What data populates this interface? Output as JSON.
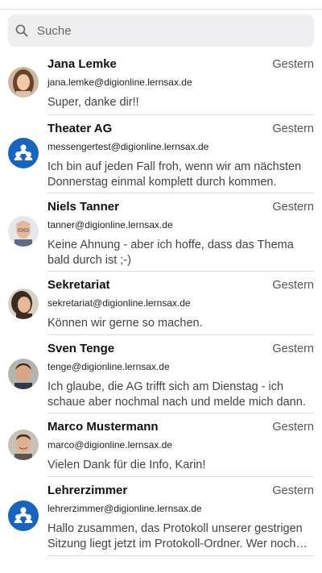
{
  "search": {
    "placeholder": "Suche"
  },
  "contacts": [
    {
      "name": "Jana Lemke",
      "time": "Gestern",
      "email": "jana.lemke@digionline.lernsax.de",
      "preview": "Super, danke dir!!",
      "avatar": "photo-woman-brown-hair"
    },
    {
      "name": "Theater AG",
      "time": "Gestern",
      "email": "messengertest@digionline.lernsax.de",
      "preview": "Ich bin auf jeden Fall froh, wenn wir am nächsten Donnerstag einmal komplett durch kommen.",
      "avatar": "group-icon"
    },
    {
      "name": "Niels Tanner",
      "time": "Gestern",
      "email": "tanner@digionline.lernsax.de",
      "preview": "Keine Ahnung - aber ich hoffe, dass das Thema bald durch ist ;-)",
      "avatar": "photo-man-grey-hair"
    },
    {
      "name": "Sekretariat",
      "time": "Gestern",
      "email": "sekretariat@digionline.lernsax.de",
      "preview": "Können wir gerne so machen.",
      "avatar": "photo-woman-dark-hair"
    },
    {
      "name": "Sven Tenge",
      "time": "Gestern",
      "email": "tenge@digionline.lernsax.de",
      "preview": "Ich glaube, die AG trifft sich am Dienstag - ich schaue aber nochmal nach und melde mich dann.",
      "avatar": "photo-man-dark-hair"
    },
    {
      "name": "Marco Mustermann",
      "time": "Gestern",
      "email": "marco@digionline.lernsax.de",
      "preview": "Vielen Dank für die Info, Karin!",
      "avatar": "photo-man-smiling"
    },
    {
      "name": "Lehrerzimmer",
      "time": "Gestern",
      "email": "lehrerzimmer@digionline.lernsax.de",
      "preview": "Hallo zusammen, das Protokoll unserer gestrigen Sitzung liegt jetzt im Protokoll-Ordner. Wer noch Fragen hat, bitte melden.",
      "avatar": "group-icon"
    }
  ],
  "colors": {
    "accent": "#1565c0",
    "search_bg": "#eeeef0",
    "divider": "#dcdcdc"
  }
}
